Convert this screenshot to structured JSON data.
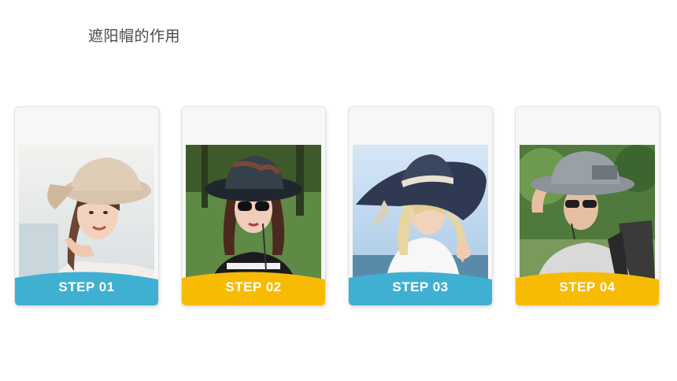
{
  "page": {
    "title": "遮阳帽的作用"
  },
  "colors": {
    "blue": "#3fb0d1",
    "yellow": "#f8bb04"
  },
  "cards": [
    {
      "step": "STEP 01",
      "color": "#3fb0d1",
      "photo": "woman-beige-bow-hat-photo"
    },
    {
      "step": "STEP 02",
      "color": "#f8bb04",
      "photo": "woman-camo-bucket-hat-sunglasses-photo"
    },
    {
      "step": "STEP 03",
      "color": "#3fb0d1",
      "photo": "woman-navy-wide-brim-hat-photo"
    },
    {
      "step": "STEP 04",
      "color": "#f8bb04",
      "photo": "man-grey-boonie-hat-backpack-photo"
    }
  ]
}
